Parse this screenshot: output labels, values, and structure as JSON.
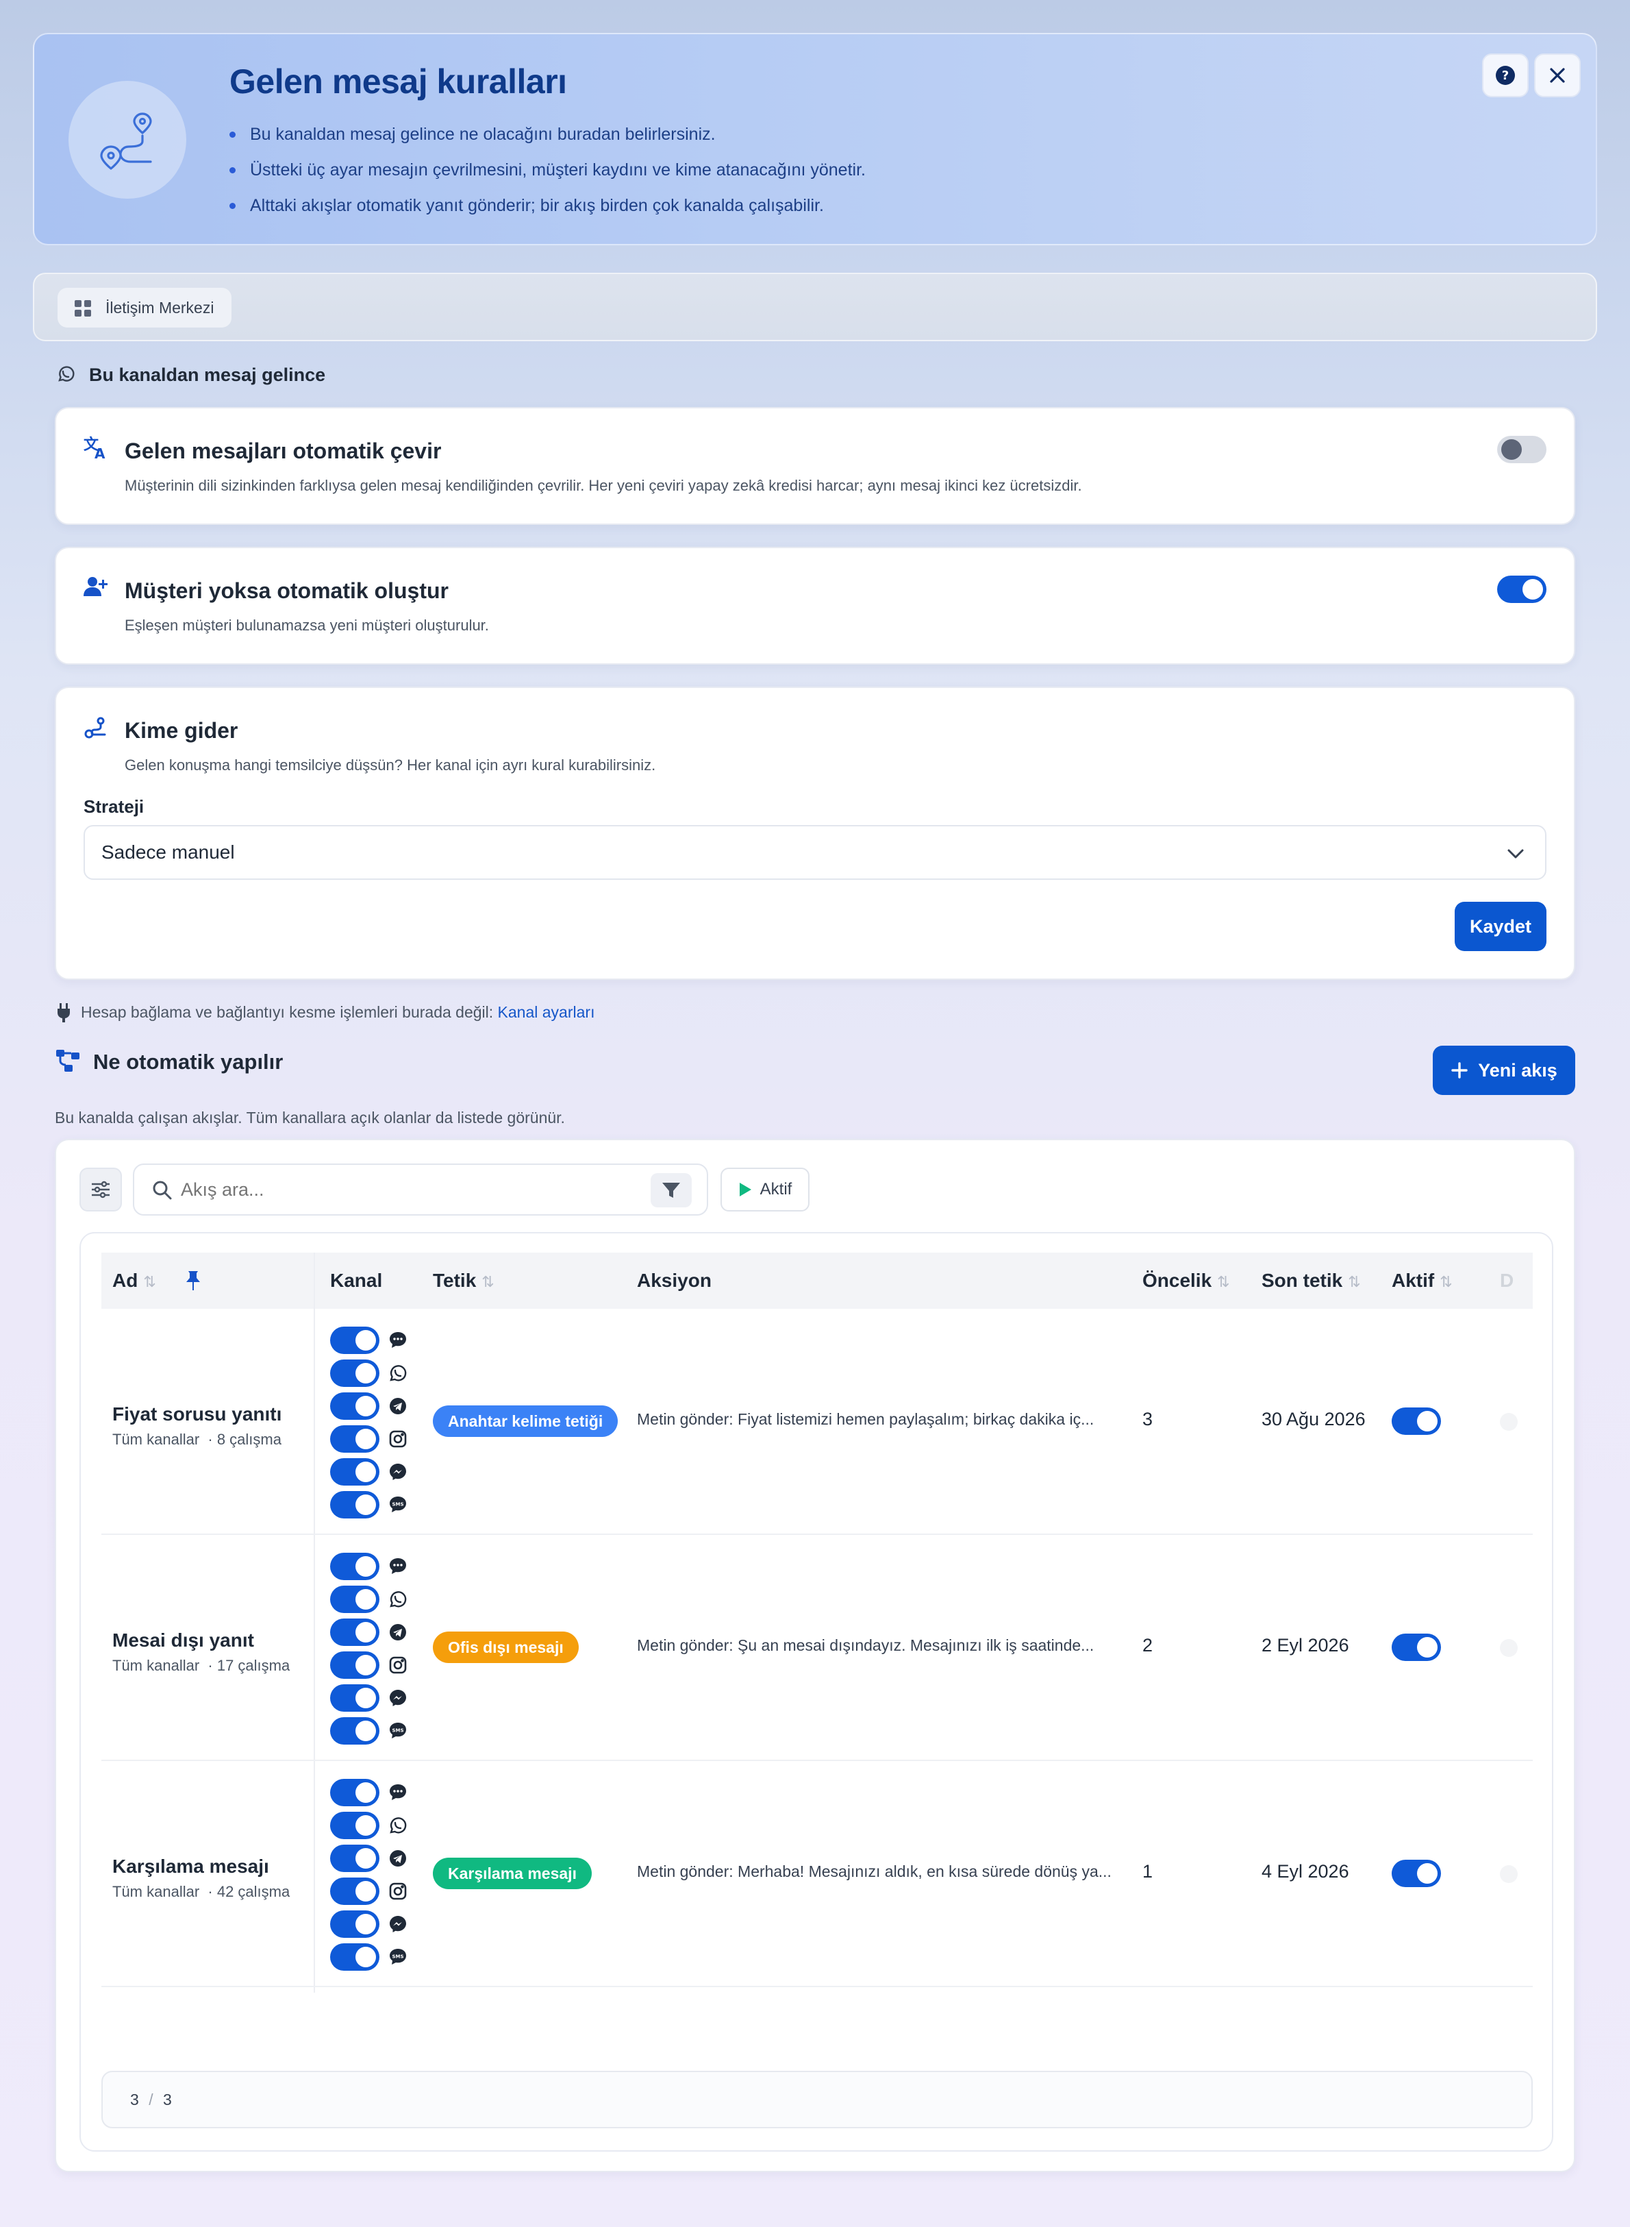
{
  "hero": {
    "title": "Gelen mesaj kuralları",
    "bullets": [
      "Bu kanaldan mesaj gelince ne olacağını buradan belirlersiniz.",
      "Üstteki üç ayar mesajın çevrilmesini, müşteri kaydını ve kime atanacağını yönetir.",
      "Alttaki akışlar otomatik yanıt gönderir; bir akış birden çok kanalda çalışabilir."
    ]
  },
  "breadcrumb": {
    "label": "İletişim Merkezi"
  },
  "incoming": {
    "heading": "Bu kanaldan mesaj gelince"
  },
  "translate": {
    "title": "Gelen mesajları otomatik çevir",
    "desc": "Müşterinin dili sizinkinden farklıysa gelen mesaj kendiliğinden çevrilir. Her yeni çeviri yapay zekâ kredisi harcar; aynı mesaj ikinci kez ücretsizdir.",
    "enabled": false
  },
  "autocreate": {
    "title": "Müşteri yoksa otomatik oluştur",
    "desc": "Eşleşen müşteri bulunamazsa yeni müşteri oluşturulur.",
    "enabled": true
  },
  "routing": {
    "title": "Kime gider",
    "desc": "Gelen konuşma hangi temsilciye düşsün? Her kanal için ayrı kural kurabilirsiniz.",
    "strategy_label": "Strateji",
    "strategy_value": "Sadece manuel",
    "save_label": "Kaydet"
  },
  "hint": {
    "text": "Hesap bağlama ve bağlantıyı kesme işlemleri burada değil: ",
    "link": "Kanal ayarları"
  },
  "flows": {
    "heading": "Ne otomatik yapılır",
    "new_label": "Yeni akış",
    "desc": "Bu kanalda çalışan akışlar. Tüm kanallara açık olanlar da listede görünür.",
    "search_placeholder": "Akış ara...",
    "active_filter": "Aktif",
    "columns": {
      "name": "Ad",
      "channel": "Kanal",
      "trigger": "Tetik",
      "action": "Aksiyon",
      "priority": "Öncelik",
      "last": "Son tetik",
      "active": "Aktif",
      "extra": "D"
    },
    "rows": [
      {
        "name": "Fiyat sorusu yanıtı",
        "scope": "Tüm kanallar",
        "runs": "· 8 çalışma",
        "trigger": "Anahtar kelime tetiği",
        "trigger_color": "#3b82f6",
        "action": "Metin gönder: Fiyat listemizi hemen paylaşalım; birkaç dakika iç...",
        "priority": "3",
        "last": "30 Ağu 2026",
        "active": true
      },
      {
        "name": "Mesai dışı yanıt",
        "scope": "Tüm kanallar",
        "runs": "· 17 çalışma",
        "trigger": "Ofis dışı mesajı",
        "trigger_color": "#f59e0b",
        "action": "Metin gönder: Şu an mesai dışındayız. Mesajınızı ilk iş saatinde...",
        "priority": "2",
        "last": "2 Eyl 2026",
        "active": true
      },
      {
        "name": "Karşılama mesajı",
        "scope": "Tüm kanallar",
        "runs": "· 42 çalışma",
        "trigger": "Karşılama mesajı",
        "trigger_color": "#10b981",
        "action": "Metin gönder: Merhaba! Mesajınızı aldık, en kısa sürede dönüş ya...",
        "priority": "1",
        "last": "4 Eyl 2026",
        "active": true
      }
    ],
    "pager": {
      "current": "3",
      "sep": "/",
      "total": "3"
    }
  },
  "icons": {
    "channels": [
      "chat-icon",
      "whatsapp-icon",
      "telegram-icon",
      "instagram-icon",
      "messenger-icon",
      "sms-icon"
    ]
  }
}
